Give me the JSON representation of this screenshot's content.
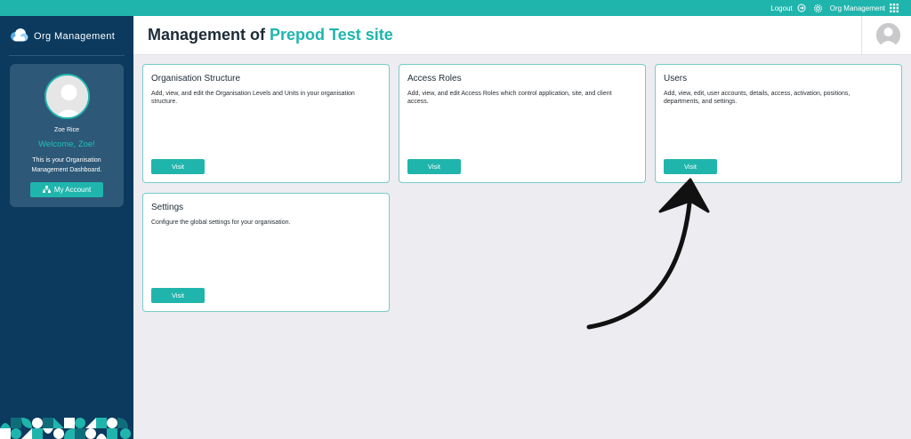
{
  "topbar": {
    "logout_label": "Logout",
    "app_label": "Org Management",
    "icons": [
      "logout-icon",
      "gear-icon",
      "apps-grid-icon"
    ]
  },
  "sidebar": {
    "brand": "Org Management",
    "profile": {
      "name": "Zoe Rice",
      "welcome": "Welcome, Zoe!",
      "intro": "This is your Organisation Management Dashboard.",
      "account_button": "My Account"
    }
  },
  "header": {
    "title_prefix": "Management of",
    "site_name": "Prepod Test site"
  },
  "cards": [
    {
      "title": "Organisation Structure",
      "description": "Add, view, and edit the Organisation Levels and Units in your organisation structure.",
      "button": "Visit"
    },
    {
      "title": "Access Roles",
      "description": "Add, view, and edit Access Roles which control application, site, and client access.",
      "button": "Visit"
    },
    {
      "title": "Users",
      "description": "Add, view, edit, user accounts, details, access, activation, positions, departments, and settings.",
      "button": "Visit"
    },
    {
      "title": "Settings",
      "description": "Configure the global settings for your organisation.",
      "button": "Visit"
    }
  ],
  "colors": {
    "accent": "#1fb5ad",
    "sidebar": "#0b3a5e",
    "profile_card": "#2d5877",
    "background": "#ececf1",
    "card_border": "#78ccc8"
  }
}
